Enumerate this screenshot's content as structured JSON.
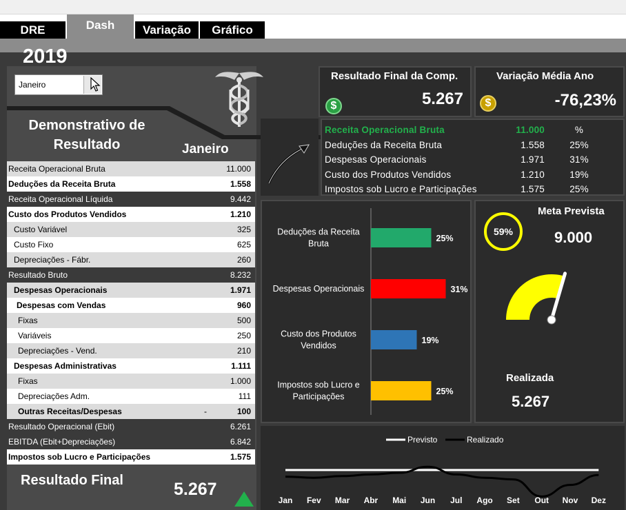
{
  "tabs": [
    {
      "label": "DRE",
      "active": false
    },
    {
      "label": "Dash",
      "active": true
    },
    {
      "label": "Variação",
      "active": false
    },
    {
      "label": "Gráfico",
      "active": false
    }
  ],
  "year": "2019",
  "month_select": {
    "value": "Janeiro"
  },
  "dre": {
    "title_line1": "Demonstrativo de",
    "title_line2": "Resultado",
    "month": "Janeiro",
    "rows": [
      {
        "label": "Receita Operacional Bruta",
        "value": "11.000"
      },
      {
        "label": "Deduções da Receita Bruta",
        "value": "1.558"
      },
      {
        "label": "Receita Operacional Líquida",
        "value": "9.442"
      },
      {
        "label": "Custo dos Produtos Vendidos",
        "value": "1.210"
      },
      {
        "label": "Custo Variável",
        "value": "325"
      },
      {
        "label": "Custo Fixo",
        "value": "625"
      },
      {
        "label": "Depreciações - Fábr.",
        "value": "260"
      },
      {
        "label": "Resultado Bruto",
        "value": "8.232"
      },
      {
        "label": "Despesas Operacionais",
        "value": "1.971"
      },
      {
        "label": "Despesas com Vendas",
        "value": "960"
      },
      {
        "label": "Fixas",
        "value": "500"
      },
      {
        "label": "Variáveis",
        "value": "250"
      },
      {
        "label": "Depreciações - Vend.",
        "value": "210"
      },
      {
        "label": "Despesas Administrativas",
        "value": "1.111"
      },
      {
        "label": "Fixas",
        "value": "1.000"
      },
      {
        "label": "Depreciações Adm.",
        "value": "111"
      },
      {
        "label": "Outras Receitas/Despesas",
        "dash": "-",
        "value": "100"
      },
      {
        "label": "Resultado Operacional (Ebit)",
        "value": "6.261"
      },
      {
        "label": "EBITDA (Ebit+Depreciações)",
        "value": "6.842"
      },
      {
        "label": "Impostos sob Lucro e Participações",
        "value": "1.575"
      }
    ],
    "final_label": "Resultado Final",
    "final_value": "5.267"
  },
  "card_result": {
    "title": "Resultado Final da Comp.",
    "value": "5.267",
    "icon": "dollar-coin-icon"
  },
  "card_variation": {
    "title": "Variação Média Ano",
    "value": "-76,23%",
    "icon": "dollar-coin-icon"
  },
  "summary": {
    "rows": [
      {
        "label": "Receita Operacional Bruta",
        "value": "11.000",
        "pct": "%"
      },
      {
        "label": "Deduções da Receita Bruta",
        "value": "1.558",
        "pct": "25%"
      },
      {
        "label": "Despesas Operacionais",
        "value": "1.971",
        "pct": "31%"
      },
      {
        "label": "Custo dos Produtos Vendidos",
        "value": "1.210",
        "pct": "19%"
      },
      {
        "label": "Impostos sob Lucro e Participações",
        "value": "1.575",
        "pct": "25%"
      }
    ]
  },
  "meta": {
    "title": "Meta Prevista",
    "value": "9.000",
    "percent_label": "59%",
    "realizada_label": "Realizada",
    "realizada_value": "5.267"
  },
  "chart_data": [
    {
      "type": "bar",
      "orientation": "horizontal",
      "categories": [
        "Deduções da Receita Bruta",
        "Despesas Operacionais",
        "Custo dos Produtos Vendidos",
        "Impostos sob Lucro e Participações"
      ],
      "category_lines": [
        [
          "Deduções da Receita",
          "Bruta"
        ],
        [
          "Despesas Operacionais"
        ],
        [
          "Custo dos Produtos",
          "Vendidos"
        ],
        [
          "Impostos sob Lucro e",
          "Participações"
        ]
      ],
      "values": [
        25,
        31,
        19,
        25
      ],
      "labels": [
        "25%",
        "31%",
        "19%",
        "25%"
      ],
      "colors": [
        "#22a96b",
        "#ff0000",
        "#2e75b6",
        "#ffc000"
      ],
      "xlim": [
        0,
        40
      ]
    },
    {
      "type": "gauge",
      "value": 59,
      "range": [
        0,
        100
      ],
      "color": "#ffff00"
    },
    {
      "type": "line",
      "categories": [
        "Jan",
        "Fev",
        "Mar",
        "Abr",
        "Mai",
        "Jun",
        "Jul",
        "Ago",
        "Set",
        "Out",
        "Nov",
        "Dez"
      ],
      "series": [
        {
          "name": "Previsto",
          "color": "#ffffff",
          "values": [
            9000,
            9000,
            9000,
            9000,
            9000,
            9000,
            9000,
            9000,
            9000,
            9000,
            9000,
            9000
          ]
        },
        {
          "name": "Realizado",
          "color": "#000000",
          "values": [
            7800,
            7600,
            7900,
            8200,
            8500,
            9600,
            8200,
            7600,
            7300,
            4200,
            6300,
            8100
          ]
        }
      ],
      "ylim": [
        0,
        12000
      ],
      "legend": "top-center"
    }
  ]
}
